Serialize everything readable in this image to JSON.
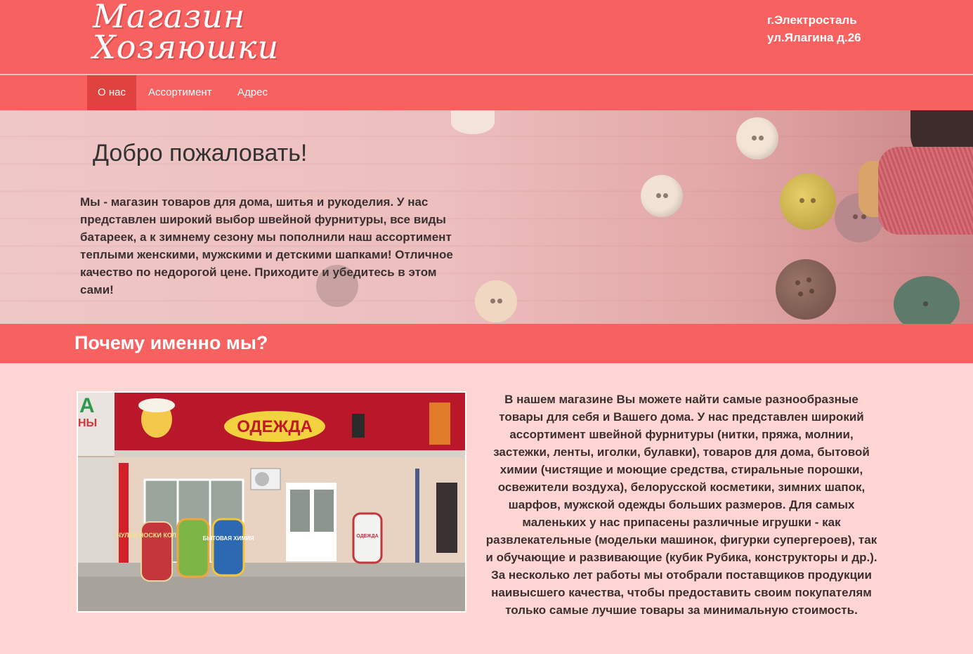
{
  "header": {
    "logo_line1": "Магазин",
    "logo_line2": "Хозяюшки",
    "address_line1": "г.Электросталь",
    "address_line2": "ул.Ялагина д.26"
  },
  "nav": {
    "items": [
      {
        "label": "О нас",
        "active": true
      },
      {
        "label": "Ассортимент",
        "active": false
      },
      {
        "label": "Адрес",
        "active": false
      }
    ]
  },
  "hero": {
    "title": "Добро пожаловать!",
    "text": "Мы - магазин товаров для дома, шитья и рукоделия. У нас представлен широкий выбор швейной фурнитуры, все виды батареек, а к зимнему сезону мы пополнили наш ассортимент теплыми женскими, мужскими и детскими шапками! Отличное качество по недорогой цене. Приходите и убедитесь в этом сами!"
  },
  "why": {
    "title": "Почему именно мы?",
    "text": "В нашем магазине Вы можете найти самые разнообразные товары для себя и Вашего дома. У нас представлен широкий ассортимент швейной фурнитуры (нитки, пряжа, молнии, застежки, ленты, иголки, булавки), товаров для дома, бытовой химии (чистящие и моющие средства, стиральные порошки, освежители воздуха), белорусской косметики, зимних шапок, шарфов, мужской одежды больших размеров. Для самых маленьких у нас припасены различные игрушки - как развлекательные (модельки машинок, фигурки супергероев), так и обучающие и развивающие (кубик Рубика, конструкторы и др.). За несколько лет работы мы отобрали поставщиков продукции наивысшего качества, чтобы предоставить своим покупателям только самые лучшие товары за минимальную стоимость."
  },
  "photo": {
    "sign": "ОДЕЖДА",
    "sign_left_fragment": "А",
    "sign_left_fragment2": "НЫ",
    "board1": "ЧУЛКИ НОСКИ КОЛГОТКИ",
    "board3": "БЫТОВАЯ ХИМИЯ",
    "board4": "ОДЕЖДА"
  },
  "colors": {
    "primary": "#f76160",
    "active_nav": "#e0433f",
    "background": "#ffd6d3"
  }
}
